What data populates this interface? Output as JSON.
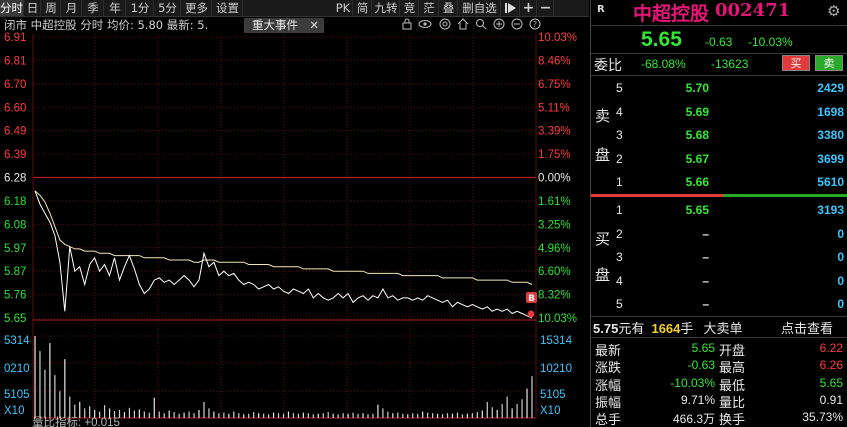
{
  "toolbar": {
    "left_tabs": [
      "分时",
      "日",
      "周",
      "月",
      "季",
      "年",
      "1分",
      "5分",
      "更多",
      "设置"
    ],
    "right_tabs": [
      "PK",
      "简",
      "九转",
      "竞",
      "茫",
      "叠",
      "删自选"
    ],
    "right_icons": [
      "play-icon",
      "plus-icon",
      "minus-icon"
    ]
  },
  "subheader": {
    "text": "闭市  中超控股 分时 均价: 5.80 最新: 5.",
    "event_button": "重大事件",
    "close": "✕"
  },
  "chart": {
    "prices_left": [
      "6.91",
      "6.81",
      "6.70",
      "6.60",
      "6.49",
      "6.39",
      "6.28",
      "6.18",
      "6.08",
      "5.97",
      "5.87",
      "5.76",
      "5.65"
    ],
    "pcts_right": [
      "10.03%",
      "8.46%",
      "6.75%",
      "5.11%",
      "3.39%",
      "1.75%",
      "0.00%",
      "1.61%",
      "3.25%",
      "4.96%",
      "6.60%",
      "8.32%",
      "10.03%"
    ],
    "vol_left": [
      "5314",
      "0210",
      "5105",
      "X10"
    ],
    "vol_right": [
      "15314",
      "10210",
      "5105",
      "X10"
    ],
    "bottom_label": "量比指标: +0.015",
    "marker": "B"
  },
  "chart_data": {
    "type": "line",
    "title": "",
    "ylim": [
      5.65,
      6.91
    ],
    "prev_close": 6.28,
    "series": [
      {
        "values": [
          6.22,
          6.16,
          6.12,
          6.08,
          6.02,
          5.9,
          5.68,
          5.97,
          5.86,
          5.88,
          5.8,
          5.89,
          5.92,
          5.86,
          5.89,
          5.84,
          5.92,
          5.82,
          5.88,
          5.93,
          5.87,
          5.8,
          5.76,
          5.78,
          5.82,
          5.83,
          5.81,
          5.82,
          5.8,
          5.82,
          5.84,
          5.82,
          5.79,
          5.82,
          5.94,
          5.88,
          5.9,
          5.84,
          5.86,
          5.84,
          5.85,
          5.82,
          5.8,
          5.81,
          5.8,
          5.78,
          5.79,
          5.8,
          5.78,
          5.79,
          5.77,
          5.76,
          5.78,
          5.77,
          5.76,
          5.78,
          5.74,
          5.76,
          5.74,
          5.73,
          5.74,
          5.76,
          5.74,
          5.76,
          5.72,
          5.74,
          5.75,
          5.73,
          5.75,
          5.74,
          5.78,
          5.74,
          5.75,
          5.73,
          5.74,
          5.74,
          5.73,
          5.74,
          5.73,
          5.75,
          5.74,
          5.73,
          5.72,
          5.73,
          5.7,
          5.72,
          5.71,
          5.7,
          5.71,
          5.7,
          5.69,
          5.7,
          5.68,
          5.69,
          5.68,
          5.69,
          5.67,
          5.68,
          5.67,
          5.66,
          5.65
        ]
      },
      {
        "values": [
          6.22,
          6.2,
          6.17,
          6.12,
          6.06,
          6.0,
          5.98,
          5.97,
          5.96,
          5.96,
          5.95,
          5.95,
          5.95,
          5.94,
          5.94,
          5.94,
          5.93,
          5.93,
          5.93,
          5.93,
          5.93,
          5.93,
          5.92,
          5.92,
          5.92,
          5.92,
          5.92,
          5.91,
          5.91,
          5.91,
          5.91,
          5.91,
          5.9,
          5.9,
          5.91,
          5.91,
          5.91,
          5.9,
          5.9,
          5.9,
          5.9,
          5.9,
          5.9,
          5.89,
          5.89,
          5.89,
          5.89,
          5.89,
          5.88,
          5.88,
          5.88,
          5.88,
          5.88,
          5.88,
          5.87,
          5.87,
          5.87,
          5.87,
          5.87,
          5.87,
          5.86,
          5.86,
          5.86,
          5.86,
          5.86,
          5.86,
          5.86,
          5.85,
          5.85,
          5.85,
          5.85,
          5.85,
          5.85,
          5.85,
          5.84,
          5.84,
          5.84,
          5.84,
          5.84,
          5.84,
          5.84,
          5.84,
          5.83,
          5.83,
          5.83,
          5.83,
          5.83,
          5.83,
          5.83,
          5.82,
          5.82,
          5.82,
          5.82,
          5.82,
          5.82,
          5.82,
          5.81,
          5.81,
          5.81,
          5.81,
          5.8
        ]
      }
    ],
    "volume": [
      15314,
      12500,
      9000,
      14000,
      8000,
      5000,
      11000,
      4000,
      2500,
      3000,
      1800,
      2200,
      1500,
      1200,
      2400,
      1800,
      1300,
      1500,
      1100,
      1900,
      1400,
      1600,
      1200,
      1000,
      3800,
      1200,
      900,
      1400,
      1100,
      800,
      1000,
      1200,
      900,
      1500,
      3000,
      1800,
      1200,
      900,
      1000,
      800,
      1200,
      900,
      700,
      800,
      1100,
      900,
      800,
      700,
      1000,
      900,
      800,
      1200,
      900,
      800,
      1000,
      900,
      700,
      800,
      900,
      1100,
      800,
      700,
      900,
      800,
      1000,
      800,
      900,
      700,
      800,
      2500,
      1800,
      1200,
      900,
      1000,
      800,
      700,
      900,
      800,
      1200,
      1000,
      900,
      800,
      700,
      900,
      800,
      1000,
      700,
      800,
      900,
      1100,
      1400,
      3000,
      2000,
      1500,
      2600,
      4000,
      1800,
      2600,
      3500,
      5500,
      7800
    ]
  },
  "quote": {
    "badge": "R",
    "name": "中超控股",
    "code": "002471",
    "price": "5.65",
    "change": "-0.63",
    "pct": "-10.03%",
    "webi_label": "委比",
    "webi": "-68.08%",
    "weicha": "-13623",
    "buy_btn": "买",
    "sell_btn": "卖"
  },
  "sell_side": {
    "label_top": "卖",
    "label_bottom": "盘",
    "rows": [
      {
        "lvl": "5",
        "price": "5.70",
        "vol": "2429"
      },
      {
        "lvl": "4",
        "price": "5.69",
        "vol": "1698"
      },
      {
        "lvl": "3",
        "price": "5.68",
        "vol": "3380"
      },
      {
        "lvl": "2",
        "price": "5.67",
        "vol": "3699"
      },
      {
        "lvl": "1",
        "price": "5.66",
        "vol": "5610"
      }
    ]
  },
  "buy_side": {
    "label_top": "买",
    "label_bottom": "盘",
    "rows": [
      {
        "lvl": "1",
        "price": "5.65",
        "vol": "3193"
      },
      {
        "lvl": "2",
        "price": "–",
        "vol": "0"
      },
      {
        "lvl": "3",
        "price": "–",
        "vol": "0"
      },
      {
        "lvl": "4",
        "price": "–",
        "vol": "0"
      },
      {
        "lvl": "5",
        "price": "–",
        "vol": "0"
      }
    ]
  },
  "big_order": {
    "price": "5.75",
    "unit1": "元有",
    "qty": "1664",
    "unit2": "手",
    "label": "大卖单",
    "link": "点击查看"
  },
  "stats": [
    {
      "k1": "最新",
      "v1": "5.65",
      "k2": "开盘",
      "v2": "6.22"
    },
    {
      "k1": "涨跌",
      "v1": "-0.63",
      "k2": "最高",
      "v2": "6.26"
    },
    {
      "k1": "涨幅",
      "v1": "-10.03%",
      "k2": "最低",
      "v2": "5.65"
    },
    {
      "k1": "振幅",
      "v1": "9.71%",
      "k2": "量比",
      "v2": "0.91"
    },
    {
      "k1": "总手",
      "v1": "466.3万",
      "k2": "换手",
      "v2": "35.73%"
    }
  ]
}
